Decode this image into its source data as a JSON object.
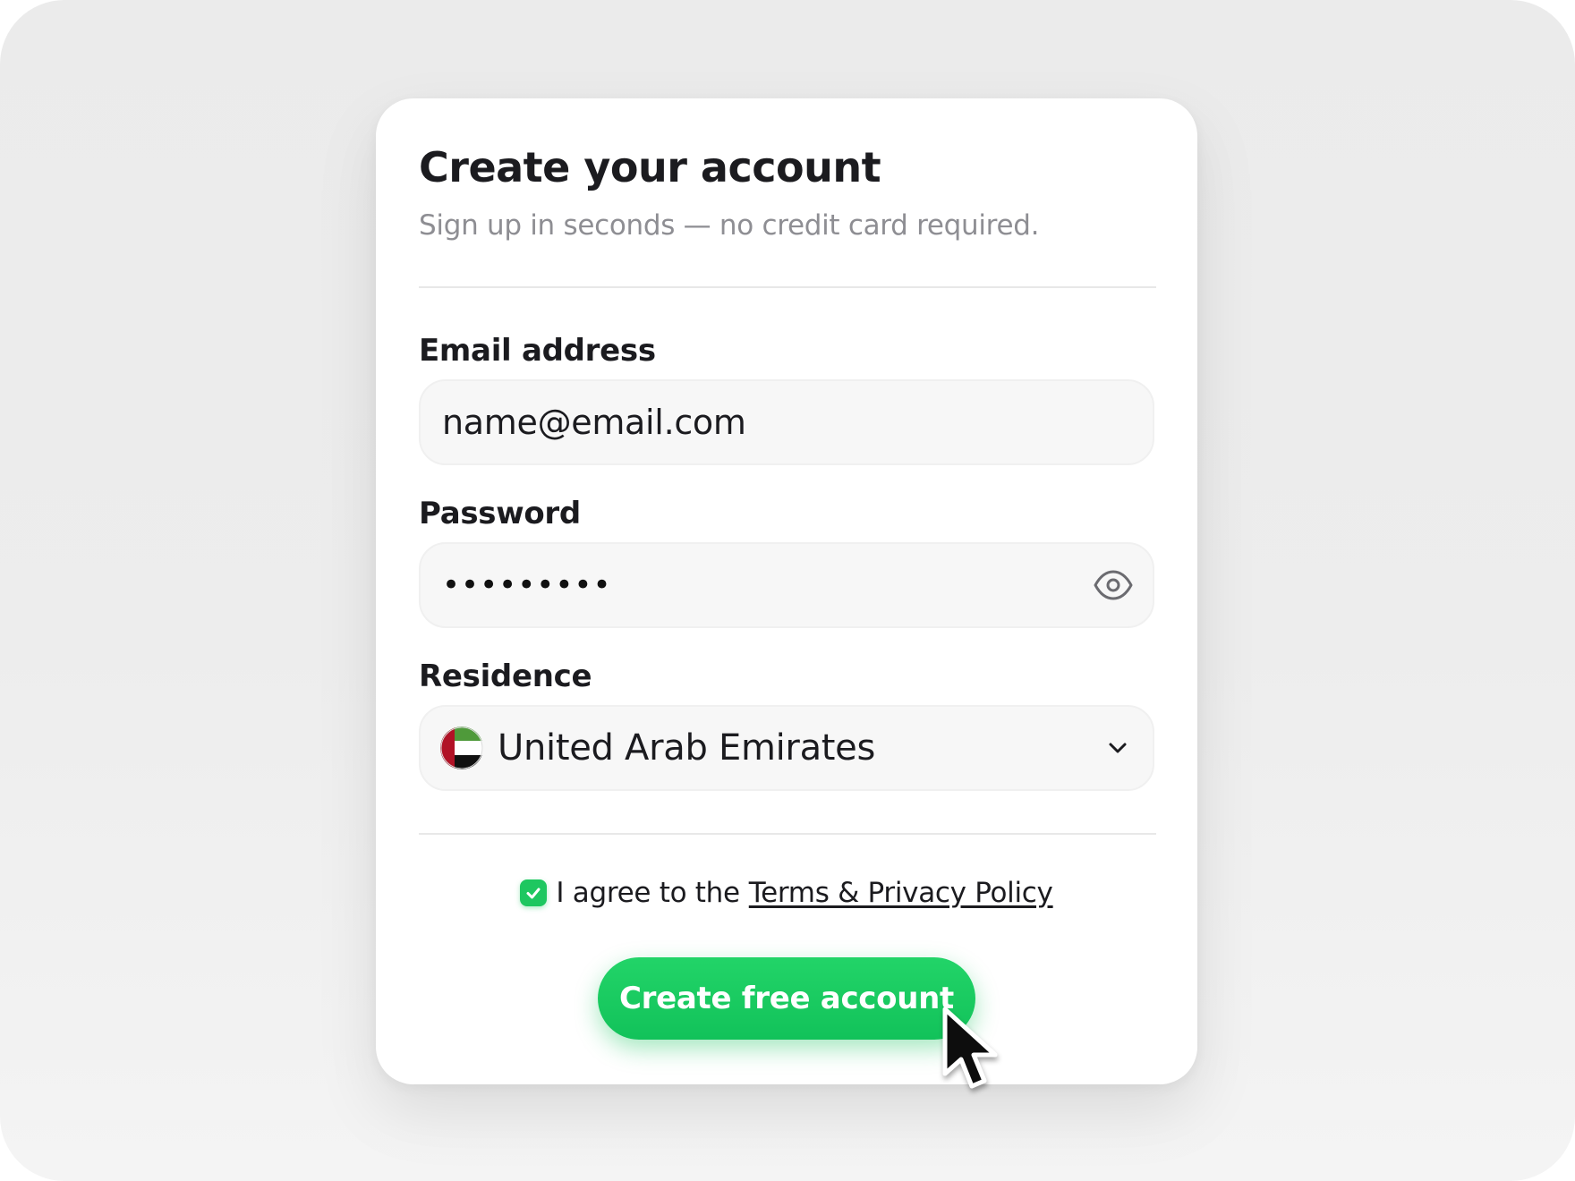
{
  "form": {
    "title": "Create your account",
    "subtitle": "Sign up in seconds — no credit card required."
  },
  "email": {
    "label": "Email address",
    "value": "name@email.com"
  },
  "password": {
    "label": "Password",
    "masked_value": "•••••••••",
    "toggle_icon": "eye-icon"
  },
  "residence": {
    "label": "Residence",
    "selected": "United Arab Emirates",
    "flag_icon": "uae-flag-icon",
    "chevron_icon": "chevron-down-icon"
  },
  "terms": {
    "checked": true,
    "prefix": "I agree to the",
    "link_text": "Terms & Privacy Policy"
  },
  "submit": {
    "label": "Create free account"
  },
  "colors": {
    "accent": "#1ec760",
    "text": "#1b1b1f",
    "muted": "#8e8e93",
    "field_bg": "#f7f7f7"
  }
}
